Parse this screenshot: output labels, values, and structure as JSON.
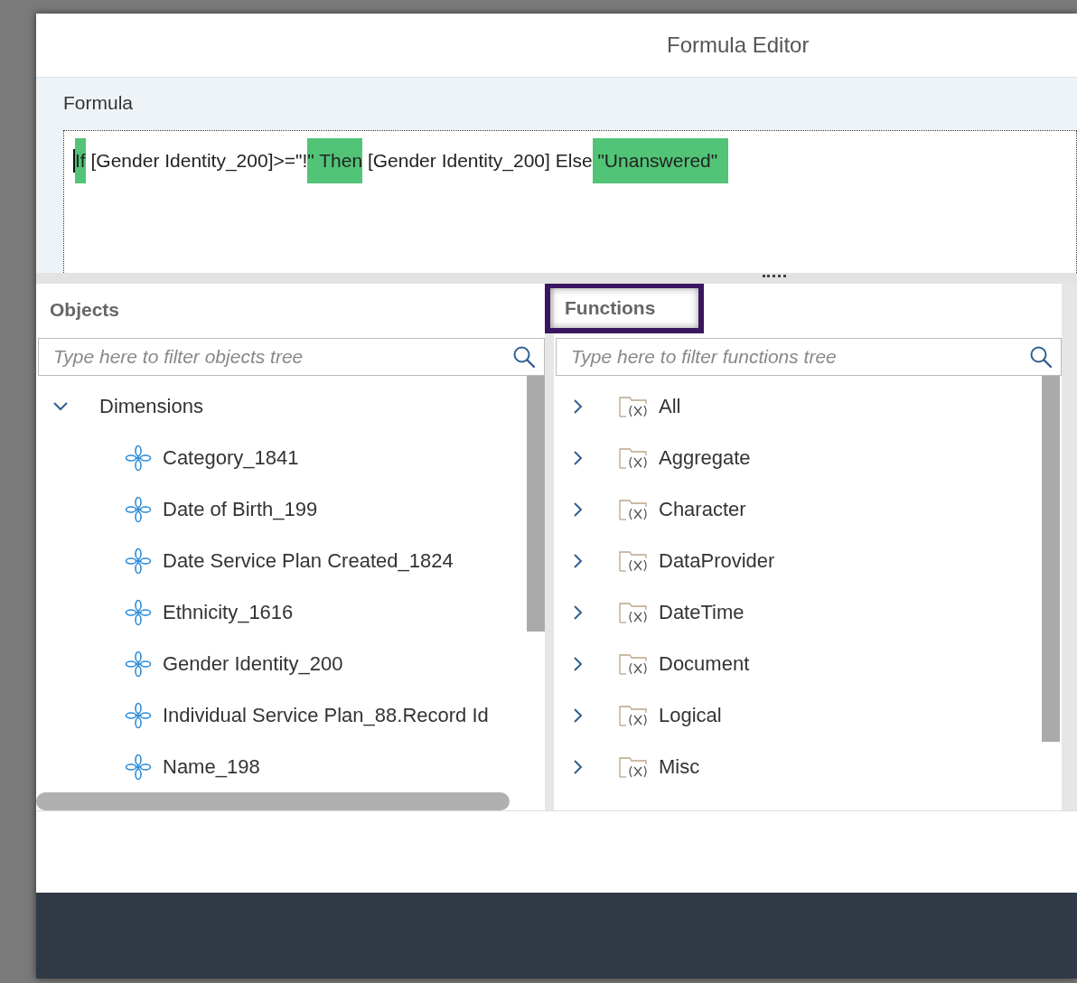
{
  "dialog": {
    "title": "Formula Editor"
  },
  "formula": {
    "label": "Formula",
    "segments": [
      {
        "text": "If",
        "highlighted": true
      },
      {
        "text": " [Gender Identity_200]>=\"!",
        "highlighted": false
      },
      {
        "text": "\" Then",
        "highlighted": true
      },
      {
        "text": " [Gender Identity_200] Else",
        "highlighted": false
      },
      {
        "text": " \"Unanswered\"  ",
        "highlighted": true
      }
    ]
  },
  "objects": {
    "title": "Objects",
    "outlined": false,
    "search": {
      "placeholder": "Type here to filter objects tree"
    },
    "tree": [
      {
        "label": "Dimensions",
        "expanded": true,
        "children": [
          {
            "label": "Category_1841"
          },
          {
            "label": "Date of Birth_199"
          },
          {
            "label": "Date Service Plan Created_1824"
          },
          {
            "label": "Ethnicity_1616"
          },
          {
            "label": "Gender Identity_200"
          },
          {
            "label": "Individual Service Plan_88.Record Id"
          },
          {
            "label": "Name_198"
          }
        ]
      }
    ]
  },
  "functions": {
    "title": "Functions",
    "outlined": true,
    "search": {
      "placeholder": "Type here to filter functions tree"
    },
    "tree": [
      {
        "label": "All",
        "expanded": false
      },
      {
        "label": "Aggregate",
        "expanded": false
      },
      {
        "label": "Character",
        "expanded": false
      },
      {
        "label": "DataProvider",
        "expanded": false
      },
      {
        "label": "DateTime",
        "expanded": false
      },
      {
        "label": "Document",
        "expanded": false
      },
      {
        "label": "Logical",
        "expanded": false
      },
      {
        "label": "Misc",
        "expanded": false
      }
    ]
  }
}
